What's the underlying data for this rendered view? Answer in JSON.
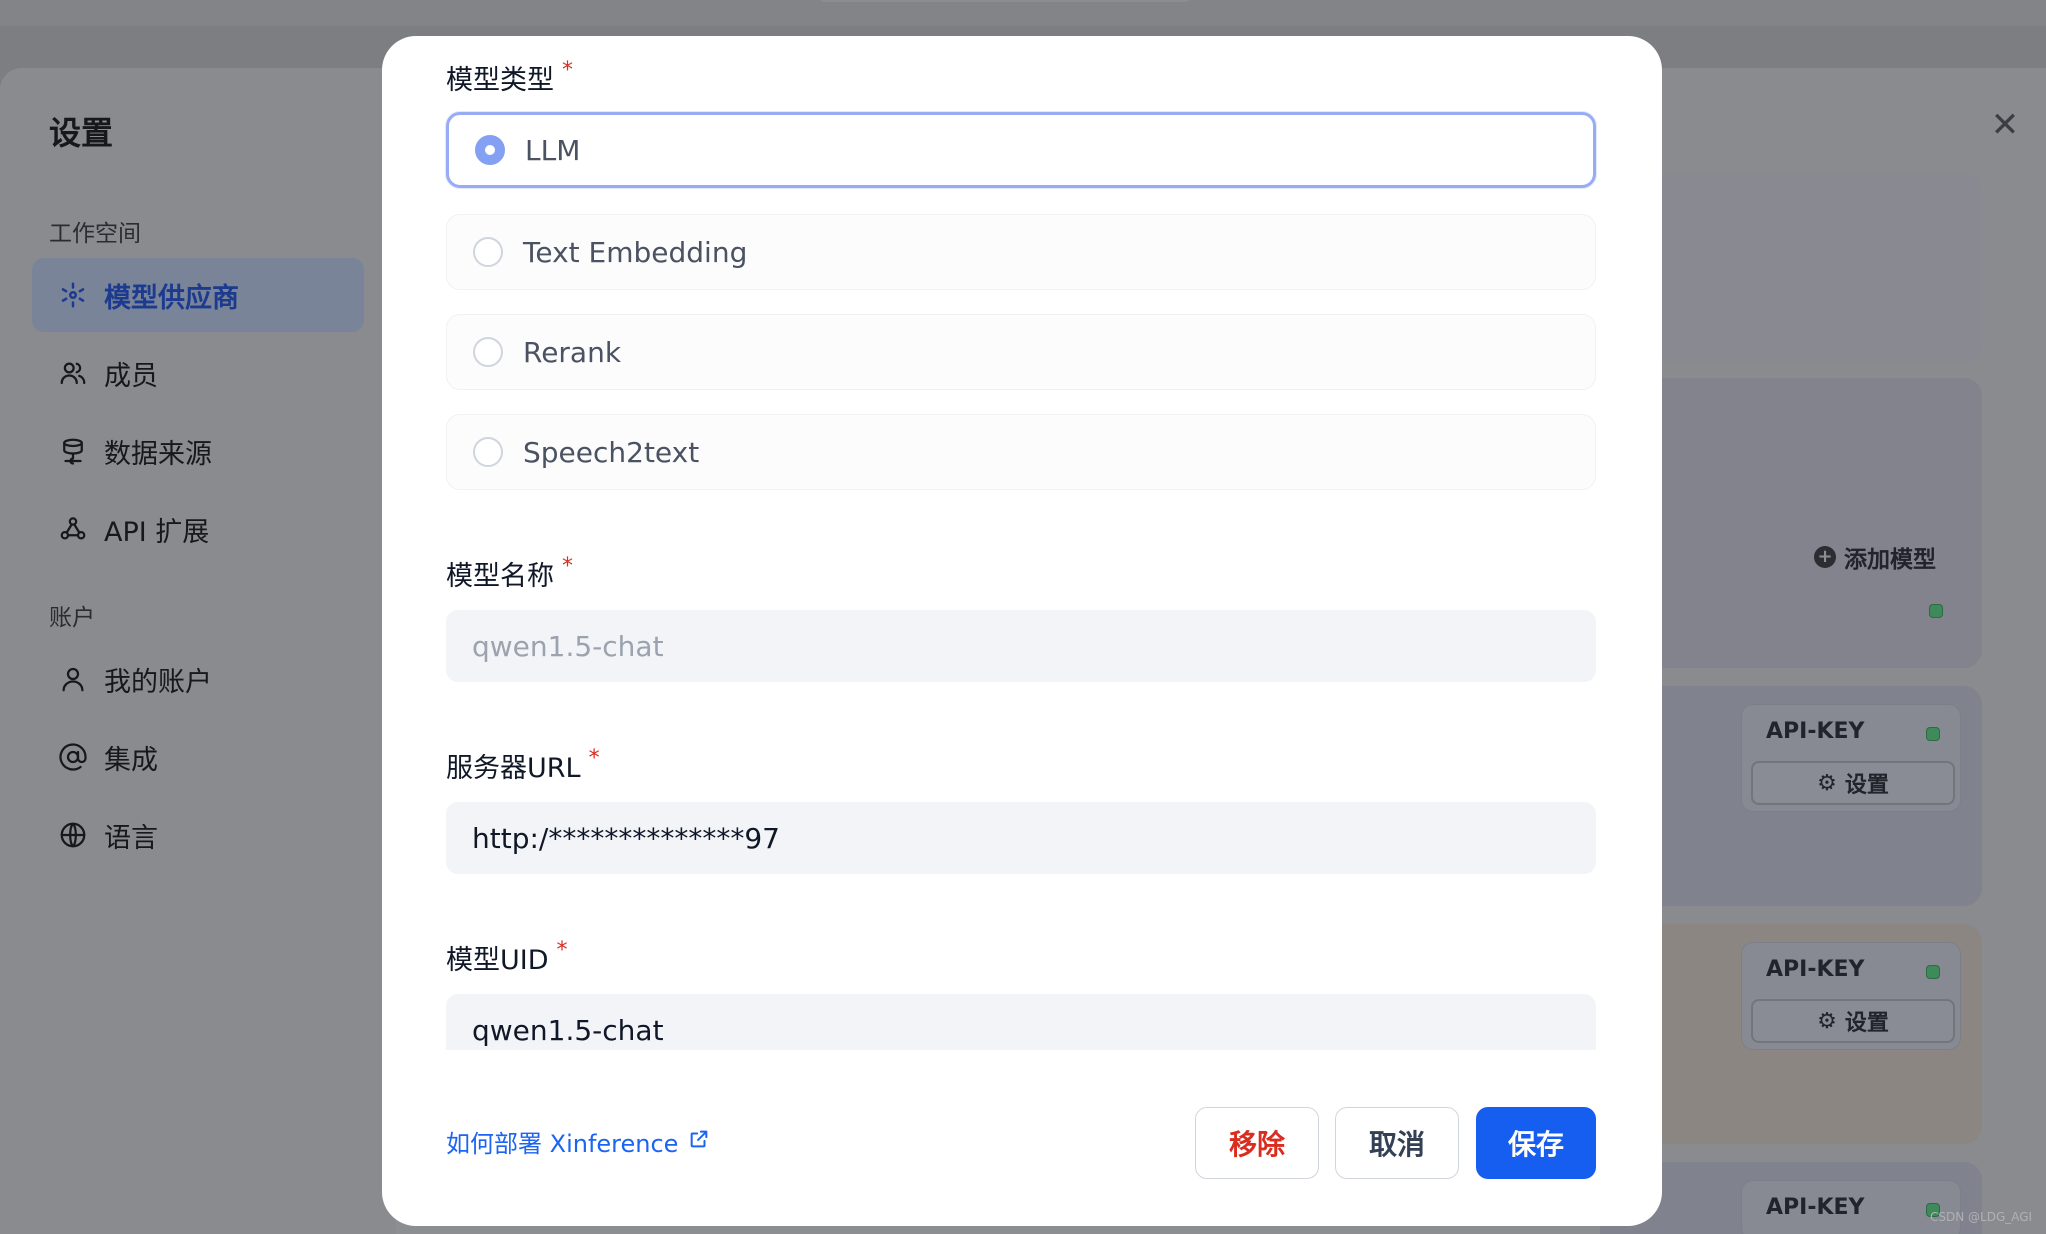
{
  "sidebar": {
    "title": "设置",
    "workspace_label": "工作空间",
    "account_label": "账户",
    "workspace_items": [
      {
        "label": "模型供应商",
        "icon": "cube-icon",
        "active": true
      },
      {
        "label": "成员",
        "icon": "users-icon",
        "active": false
      },
      {
        "label": "数据来源",
        "icon": "database-icon",
        "active": false
      },
      {
        "label": "API 扩展",
        "icon": "webhook-icon",
        "active": false
      }
    ],
    "account_items": [
      {
        "label": "我的账户",
        "icon": "user-icon"
      },
      {
        "label": "集成",
        "icon": "at-icon"
      },
      {
        "label": "语言",
        "icon": "globe-icon"
      }
    ]
  },
  "right_panel": {
    "close_glyph": "✕",
    "add_model_label": "添加模型",
    "apikey_label": "API-KEY",
    "settings_button_label": "设置",
    "status_color": "#3f8a5a"
  },
  "modal": {
    "model_type": {
      "label": "模型类型",
      "required_mark": "*",
      "options": [
        {
          "label": "LLM",
          "selected": true
        },
        {
          "label": "Text Embedding",
          "selected": false
        },
        {
          "label": "Rerank",
          "selected": false
        },
        {
          "label": "Speech2text",
          "selected": false
        }
      ]
    },
    "model_name": {
      "label": "模型名称",
      "required_mark": "*",
      "placeholder": "qwen1.5-chat",
      "value": ""
    },
    "server_url": {
      "label": "服务器URL",
      "required_mark": "*",
      "value": "http:/**************97"
    },
    "model_uid": {
      "label": "模型UID",
      "required_mark": "*",
      "value": "qwen1.5-chat"
    },
    "help_link": "如何部署 Xinference",
    "buttons": {
      "remove": "移除",
      "cancel": "取消",
      "save": "保存"
    }
  },
  "watermark": "CSDN @LDG_AGI",
  "colors": {
    "accent": "#155eef",
    "danger": "#d92d20",
    "link": "#1c64f2",
    "radio_selected": "#84a0f2"
  }
}
